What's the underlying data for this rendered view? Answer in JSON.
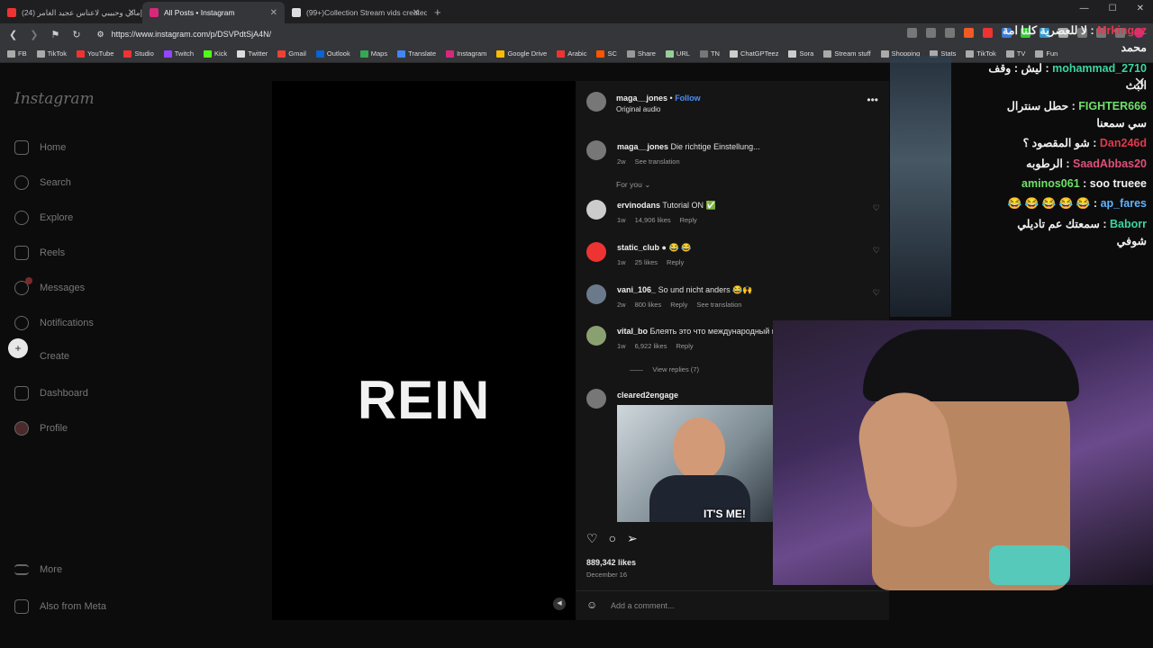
{
  "browser": {
    "tabs": [
      {
        "title": "(24) إماني وحبيبي لاعناس عجيد الغامر",
        "color": "#e33"
      },
      {
        "title": "All Posts • Instagram",
        "color": "#d6297b"
      },
      {
        "title": "(99+)Collection Stream vids created b",
        "color": "#ddd"
      }
    ],
    "url": "https://www.instagram.com/p/DSVPdtSjA4N/",
    "bookmarks": [
      {
        "label": "FB",
        "color": "#aaa"
      },
      {
        "label": "TikTok",
        "color": "#aaa"
      },
      {
        "label": "YouTube",
        "color": "#e33"
      },
      {
        "label": "Studio",
        "color": "#e33"
      },
      {
        "label": "Twitch",
        "color": "#9146ff"
      },
      {
        "label": "Kick",
        "color": "#53fc18"
      },
      {
        "label": "Twitter",
        "color": "#ddd"
      },
      {
        "label": "Gmail",
        "color": "#ea4335"
      },
      {
        "label": "Outlook",
        "color": "#0a64d4"
      },
      {
        "label": "Maps",
        "color": "#34a853"
      },
      {
        "label": "Translate",
        "color": "#4285f4"
      },
      {
        "label": "Instagram",
        "color": "#d6297b"
      },
      {
        "label": "Google Drive",
        "color": "#fbbc04"
      },
      {
        "label": "Arabic",
        "color": "#e33"
      },
      {
        "label": "SC",
        "color": "#f50"
      },
      {
        "label": "Share",
        "color": "#999"
      },
      {
        "label": "URL",
        "color": "#9c9"
      },
      {
        "label": "TN",
        "color": "#777"
      },
      {
        "label": "ChatGPTeez",
        "color": "#ccc"
      },
      {
        "label": "Sora",
        "color": "#ccc"
      },
      {
        "label": "Stream stuff",
        "color": "#aaa"
      },
      {
        "label": "Shopping",
        "color": "#aaa"
      },
      {
        "label": "Stats",
        "color": "#aaa"
      },
      {
        "label": "TikTok",
        "color": "#aaa"
      },
      {
        "label": "TV",
        "color": "#aaa"
      },
      {
        "label": "Fun",
        "color": "#aaa"
      }
    ]
  },
  "sidebar": {
    "logo": "Instagram",
    "items": [
      "Home",
      "Search",
      "Explore",
      "Reels",
      "Messages",
      "Notifications",
      "Create",
      "Dashboard",
      "Profile"
    ],
    "more": "More",
    "meta": "Also from Meta"
  },
  "video": {
    "text": "REIN"
  },
  "post": {
    "author": "maga__jones",
    "follow": "Follow",
    "audio": "Original audio",
    "caption_user": "maga__jones",
    "caption": "Die richtige Einstellung...",
    "caption_age": "2w",
    "see_translation": "See translation",
    "for_you": "For you",
    "likes": "889,342 likes",
    "date": "December 16",
    "add_comment": "Add a comment..."
  },
  "comments": [
    {
      "user": "ervinodans",
      "text": "Tutorial ON ✅",
      "age": "1w",
      "likes": "14,906 likes",
      "reply": "Reply",
      "extra": ""
    },
    {
      "user": "static_club",
      "text": "● 😂 😂",
      "age": "1w",
      "likes": "25 likes",
      "reply": "Reply",
      "extra": ""
    },
    {
      "user": "vani_106_",
      "text": "So und nicht anders 😂🙌",
      "age": "2w",
      "likes": "800 likes",
      "reply": "Reply",
      "extra": "See translation"
    },
    {
      "user": "vital_bo",
      "text": "Блеять это что международный прикол ?😂",
      "age": "1w",
      "likes": "6,922 likes",
      "reply": "Reply",
      "extra": ""
    }
  ],
  "view_replies": "View replies (7)",
  "gif_comment": {
    "user": "cleared2engage",
    "caption": "IT'S ME!"
  },
  "chat": [
    {
      "user": "Mrkingoz",
      "text": "لا للعضرية كلنا امة محمد",
      "color": "#e0394f"
    },
    {
      "user": "mohammad_2710",
      "text": "ليش : وقف البث",
      "color": "#3ad6a0"
    },
    {
      "user": "FIGHTER666",
      "text": "حطل سنترال سي سمعنا",
      "color": "#6fe06a"
    },
    {
      "user": "Dan246d",
      "text": "شو المقصود ؟",
      "color": "#e0394f"
    },
    {
      "user": "SaadAbbas20",
      "text": "الرطوبه",
      "color": "#e0507a"
    },
    {
      "user": "aminos061",
      "text": "soo trueee",
      "color": "#6fe06a"
    },
    {
      "user": "ap_fares",
      "text": "😂 😂 😂 😂 😂",
      "color": "#5fb3ff"
    },
    {
      "user": "Baborr",
      "text": "سمعتك عم تاديلي شوفي",
      "color": "#3ad6a0"
    }
  ]
}
